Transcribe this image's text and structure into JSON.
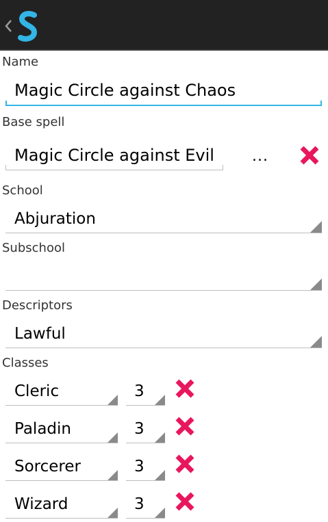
{
  "action_bar": {
    "back_icon": "chevron-left-icon",
    "logo_icon": "app-logo-s-icon",
    "logo_color": "#33b5e5"
  },
  "form": {
    "name_label": "Name",
    "name_value": "Magic Circle against Chaos",
    "base_spell_label": "Base spell",
    "base_spell_value": "Magic Circle against Evil",
    "base_spell_browse": "...",
    "school_label": "School",
    "school_value": "Abjuration",
    "subschool_label": "Subschool",
    "subschool_value": "",
    "descriptors_label": "Descriptors",
    "descriptors_value": "Lawful",
    "classes_label": "Classes",
    "classes": [
      {
        "name": "Cleric",
        "level": "3"
      },
      {
        "name": "Paladin",
        "level": "3"
      },
      {
        "name": "Sorcerer",
        "level": "3"
      },
      {
        "name": "Wizard",
        "level": "3"
      }
    ]
  },
  "colors": {
    "accent": "#33b5e5",
    "delete": "#e8175d",
    "action_bar": "#222222"
  }
}
